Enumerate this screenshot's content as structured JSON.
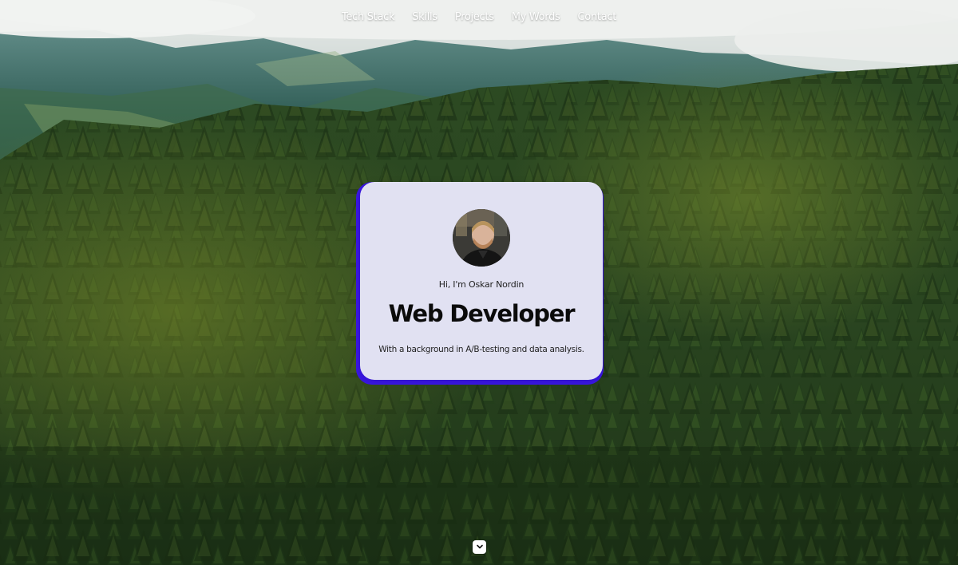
{
  "nav": {
    "items": [
      {
        "label": "Tech Stack"
      },
      {
        "label": "Skills"
      },
      {
        "label": "Projects"
      },
      {
        "label": "My Words"
      },
      {
        "label": "Contact"
      }
    ]
  },
  "hero": {
    "greeting": "Hi, I'm Oskar Nordin",
    "title": "Web Developer",
    "subtitle": "With a background in A/B-testing and data analysis."
  },
  "icons": {
    "scroll": "chevron-down-icon"
  },
  "colors": {
    "accent": "#3a16e6",
    "card": "#eceef2",
    "nav_text": "#ffffff"
  }
}
